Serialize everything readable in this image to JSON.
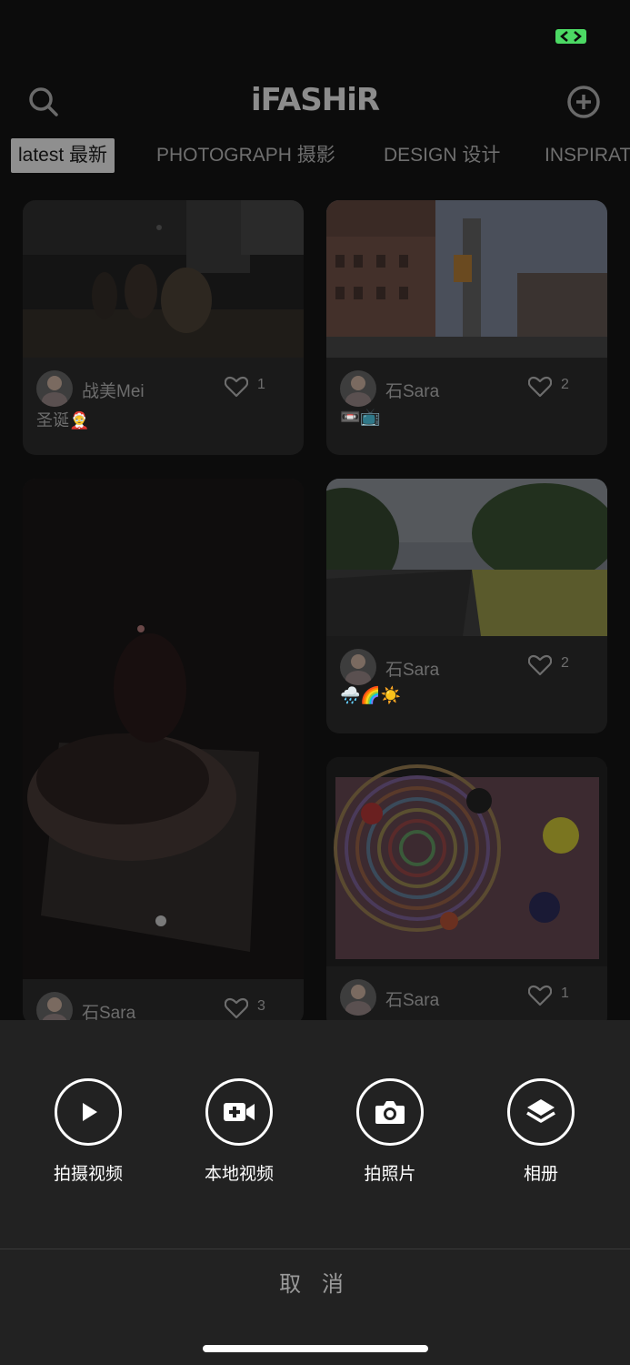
{
  "header": {
    "logo": "iFASHiR",
    "search_icon": "search-icon",
    "add_icon": "plus-circle-icon"
  },
  "tabs": [
    {
      "label": "latest 最新",
      "active": true
    },
    {
      "label": "PHOTOGRAPH 摄影",
      "active": false
    },
    {
      "label": "DESIGN 设计",
      "active": false
    },
    {
      "label": "INSPIRAT",
      "active": false
    }
  ],
  "feed": [
    {
      "author": "战美Mei",
      "likes": "1",
      "caption": "圣诞🤶"
    },
    {
      "author": "石Sara",
      "likes": "2",
      "caption": "📼📺"
    },
    {
      "author": "石Sara",
      "likes": "3",
      "caption": ""
    },
    {
      "author": "石Sara",
      "likes": "2",
      "caption": "🌧️🌈☀️"
    },
    {
      "author": "石Sara",
      "likes": "1",
      "caption": ""
    }
  ],
  "sheet": {
    "actions": [
      {
        "label": "拍摄视频",
        "icon": "play-icon"
      },
      {
        "label": "本地视频",
        "icon": "video-camera-icon"
      },
      {
        "label": "拍照片",
        "icon": "camera-icon"
      },
      {
        "label": "相册",
        "icon": "layers-icon"
      }
    ],
    "cancel": "取 消"
  },
  "colors": {
    "sheet_bg": "#222222",
    "battery": "#4cd964"
  }
}
